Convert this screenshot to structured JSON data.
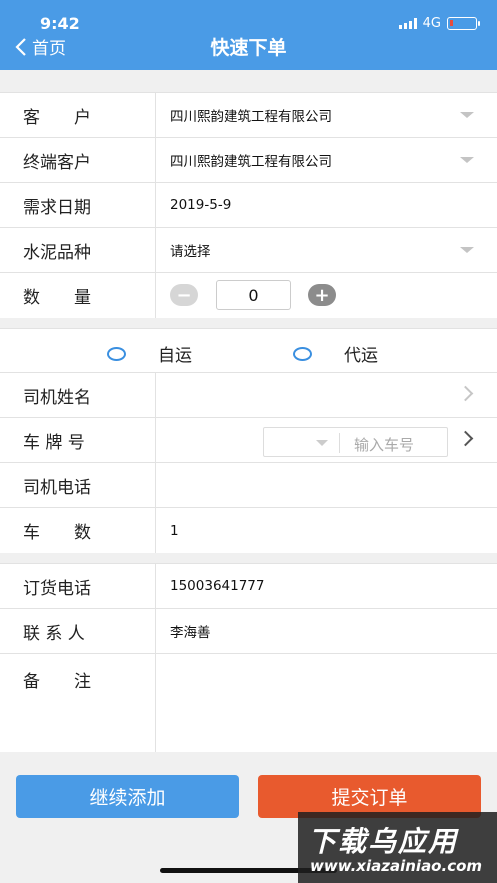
{
  "status": {
    "time": "9:42",
    "network": "4G"
  },
  "nav": {
    "back_label": "首页",
    "title": "快速下单"
  },
  "order": {
    "customer_label": "客　　户",
    "customer_value": "四川熙韵建筑工程有限公司",
    "end_customer_label": "终端客户",
    "end_customer_value": "四川熙韵建筑工程有限公司",
    "date_label": "需求日期",
    "date_value": "2019-5-9",
    "cement_label": "水泥品种",
    "cement_value": "请选择",
    "qty_label": "数　　量",
    "qty_value": "0"
  },
  "transport": {
    "option_self": "自运",
    "option_agent": "代运",
    "driver_name_label": "司机姓名",
    "plate_label": "车 牌 号",
    "plate_placeholder": "输入车号",
    "driver_phone_label": "司机电话",
    "vehicle_count_label": "车　　数",
    "vehicle_count_value": "1"
  },
  "contact": {
    "phone_label": "订货电话",
    "phone_value": "15003641777",
    "person_label": "联 系 人",
    "person_value": "李海善",
    "remark_label": "备　　注"
  },
  "actions": {
    "continue_label": "继续添加",
    "submit_label": "提交订单"
  },
  "watermark": {
    "big": "下载乌应用",
    "small": "www.xiazainiao.com"
  },
  "colors": {
    "primary": "#4a9be6",
    "submit": "#e85a2e"
  }
}
